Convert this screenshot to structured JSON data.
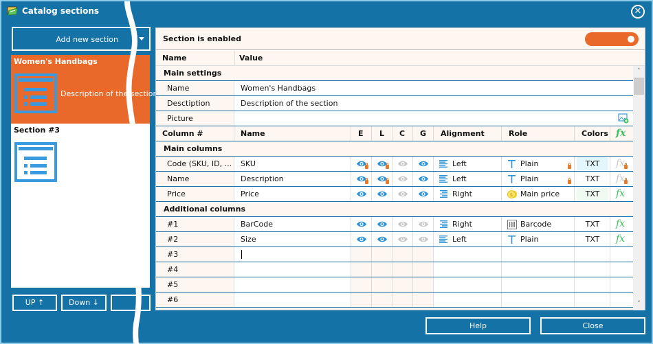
{
  "window": {
    "title": "Catalog sections",
    "app_icon": "catalog-icon",
    "close_icon": "close-circle-icon",
    "close_glyph": "✕"
  },
  "sidebar": {
    "add_button_label": "Add new section",
    "dropdown_icon": "chevron-down-icon",
    "sections": [
      {
        "title": "Women's Handbags",
        "description": "Description of the section",
        "active": true,
        "icon": "section-list-icon"
      },
      {
        "title": "Section #3",
        "description": "",
        "active": false,
        "icon": "section-list-icon"
      }
    ],
    "up_label": "UP ↑",
    "down_label": "Down ↓",
    "blank_label": ""
  },
  "panel": {
    "enabled_label": "Section is enabled",
    "enabled": true,
    "header": {
      "name": "Name",
      "value": "Value"
    },
    "main_settings": {
      "label": "Main settings",
      "rows": [
        {
          "name": "Name",
          "value": "Women's Handbags"
        },
        {
          "name": "Desctiption",
          "value": "Description of the section"
        },
        {
          "name": "Picture",
          "value": "",
          "icon": "add-picture-icon"
        }
      ]
    },
    "columns_header": {
      "column": "Column #",
      "name": "Name",
      "e": "E",
      "l": "L",
      "c": "C",
      "g": "G",
      "alignment": "Alignment",
      "role": "Role",
      "colors": "Colors",
      "fx": "fx"
    },
    "main_columns": {
      "label": "Main columns",
      "rows": [
        {
          "column": "Code (SKU, ID, ...",
          "name": "SKU",
          "e": "on-locked",
          "l": "on-locked",
          "c": "off",
          "g": "on",
          "alignment": "Left",
          "role": "Plain",
          "role_icon": "text-icon",
          "role_locked": true,
          "colors": "TXT",
          "color_bg": "#e3f6fc",
          "fx": "locked"
        },
        {
          "column": "Name",
          "name": "Description",
          "e": "on-locked",
          "l": "on-locked",
          "c": "off",
          "g": "on",
          "alignment": "Left",
          "role": "Plain",
          "role_icon": "text-icon",
          "role_locked": true,
          "colors": "TXT",
          "color_bg": "",
          "fx": "locked"
        },
        {
          "column": "Price",
          "name": "Price",
          "e": "on",
          "l": "on",
          "c": "off",
          "g": "on",
          "alignment": "Right",
          "role": "Main price",
          "role_icon": "coins-icon",
          "role_locked": false,
          "colors": "TXT",
          "color_bg": "#effaf0",
          "fx": "on"
        }
      ]
    },
    "additional_columns": {
      "label": "Additional columns",
      "rows": [
        {
          "column": "#1",
          "name": "BarCode",
          "e": "on",
          "l": "on",
          "c": "off",
          "g": "off",
          "alignment": "Right",
          "role": "Barcode",
          "role_icon": "barcode-icon",
          "colors": "TXT",
          "fx": "on"
        },
        {
          "column": "#2",
          "name": "Size",
          "e": "on",
          "l": "on",
          "c": "off",
          "g": "off",
          "alignment": "Left",
          "role": "Plain",
          "role_icon": "text-icon",
          "colors": "TXT",
          "fx": "on"
        },
        {
          "column": "#3",
          "name": "",
          "editing": true
        },
        {
          "column": "#4",
          "name": ""
        },
        {
          "column": "#5",
          "name": ""
        },
        {
          "column": "#6",
          "name": ""
        }
      ]
    }
  },
  "footer": {
    "help_label": "Help",
    "close_label": "Close"
  },
  "colors": {
    "window_bg": "#1572a7",
    "accent_orange": "#e8692a",
    "eye_on": "#2d93d8",
    "eye_off": "#c8c8c8",
    "fx_green": "#3bbf5c"
  }
}
